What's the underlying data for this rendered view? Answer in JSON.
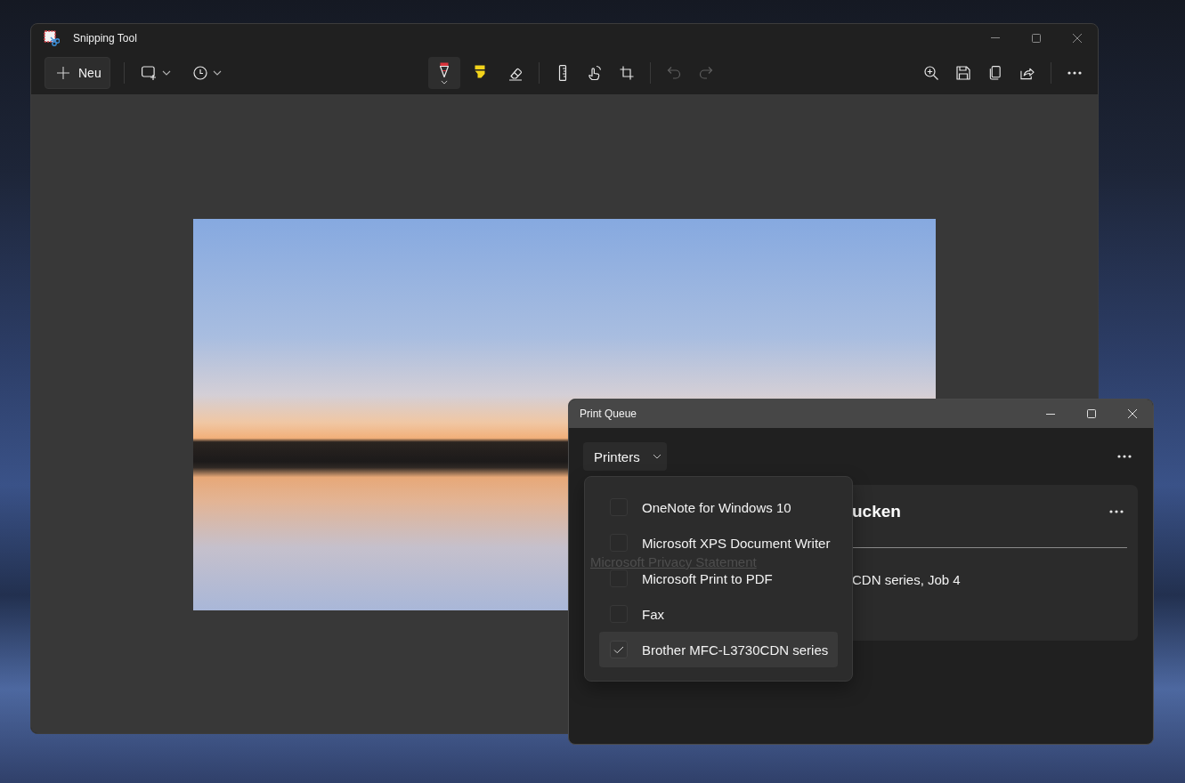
{
  "snipping_tool": {
    "title": "Snipping Tool",
    "new_button": "Neu",
    "tools": [
      {
        "kind": "pen",
        "selected": true
      },
      {
        "kind": "highlighter",
        "selected": false
      },
      {
        "kind": "eraser",
        "selected": false
      }
    ],
    "history": [
      {
        "kind": "undo",
        "disabled": true
      },
      {
        "kind": "redo",
        "disabled": true
      }
    ]
  },
  "print_queue": {
    "title": "Print Queue",
    "filter_button": "Printers",
    "printers_menu": [
      {
        "name": "OneNote for Windows 10",
        "checked": false,
        "selected": false
      },
      {
        "name": "Microsoft XPS Document Writer",
        "checked": false,
        "selected": false
      },
      {
        "name": "Microsoft Print to PDF",
        "checked": false,
        "selected": false
      },
      {
        "name": "Fax",
        "checked": false,
        "selected": false
      },
      {
        "name": "Brother MFC-L3730CDN series",
        "checked": true,
        "selected": true
      }
    ],
    "privacy_link": "Microsoft Privacy Statement",
    "job_card": {
      "title": "ucken",
      "job": "CDN series, Job 4"
    }
  }
}
